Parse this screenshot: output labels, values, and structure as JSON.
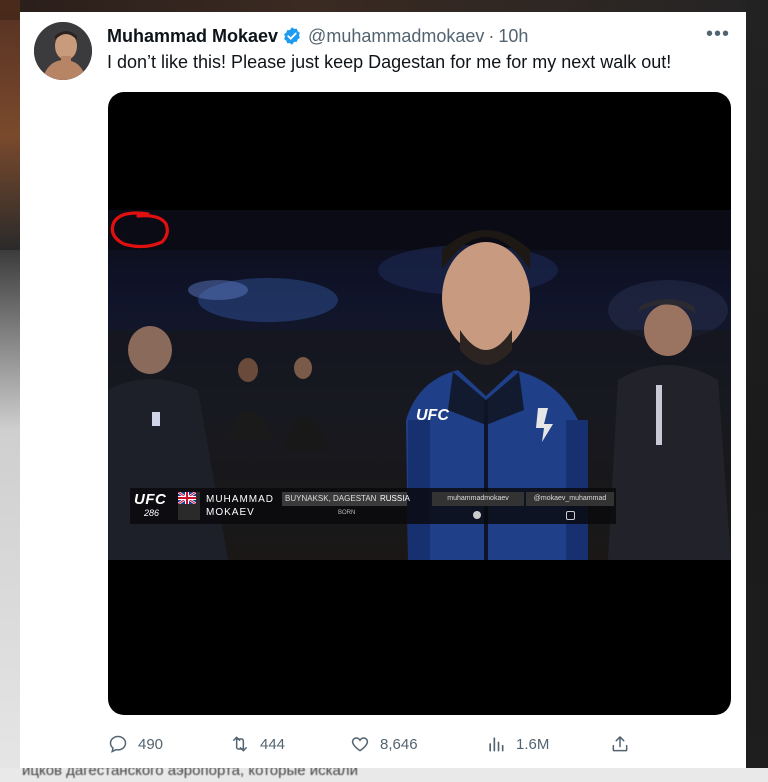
{
  "tweet": {
    "display_name": "Muhammad Mokaev",
    "handle": "@muhammadmokaev",
    "separator": "·",
    "time": "10h",
    "more_icon": "ellipsis-icon",
    "text": "I don’t like this! Please just keep Dagestan for me for my next walk out!"
  },
  "media": {
    "overlay": {
      "promo": "UFC",
      "event_number": "286",
      "rank": "12",
      "first_name": "MUHAMMAD",
      "last_name": "MOKAEV",
      "location": "BUYNAKSK, DAGESTAN",
      "country": "RUSSIA",
      "location_caption": "BORN",
      "twitter_handle": "muhammadmokaev",
      "instagram_handle": "@mokaev_muhammad"
    },
    "jacket_logo": "UFC",
    "highlight_color": "#e01010"
  },
  "actions": {
    "replies": "490",
    "retweets": "444",
    "likes": "8,646",
    "views": "1.6M"
  },
  "background": {
    "bottom_text": "ицков дагестанского аэропорта, которые искали"
  },
  "colors": {
    "name": "#0f1419",
    "secondary": "#536471",
    "verified": "#1d9bf0"
  }
}
